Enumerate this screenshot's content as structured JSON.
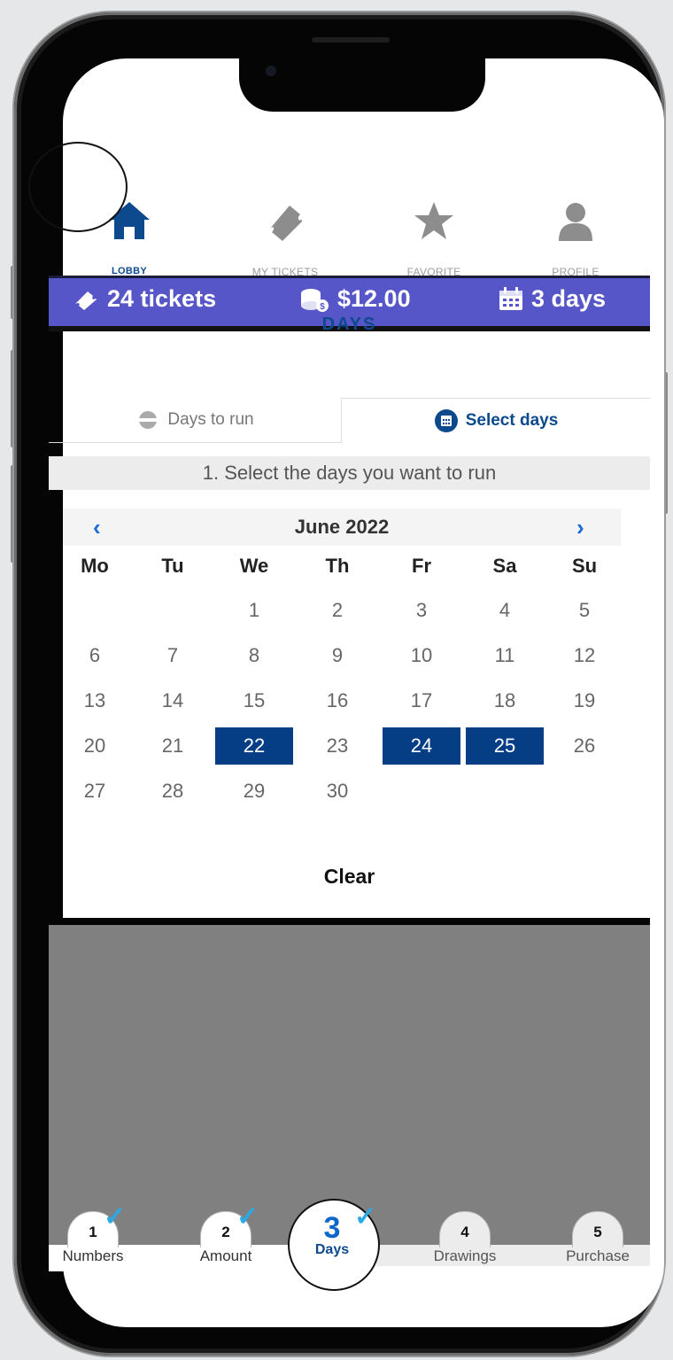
{
  "nav": {
    "items": [
      {
        "label": "LOBBY",
        "icon": "home-icon",
        "active": true
      },
      {
        "label": "MY TICKETS",
        "icon": "ticket-icon",
        "active": false
      },
      {
        "label": "FAVORITE",
        "icon": "star-icon",
        "active": false
      },
      {
        "label": "PROFILE",
        "icon": "person-icon",
        "active": false
      }
    ]
  },
  "summary": {
    "tickets": "24 tickets",
    "amount": "$12.00",
    "days": "3 days"
  },
  "days_panel": {
    "title": "DAYS",
    "tab_days_to_run": "Days to run",
    "tab_select_days": "Select days",
    "instruction": "1. Select the days you want to run",
    "month": "June 2022",
    "prev": "‹",
    "next": "›",
    "weekdays": [
      "Mo",
      "Tu",
      "We",
      "Th",
      "Fr",
      "Sa",
      "Su"
    ],
    "weeks": [
      [
        "",
        "",
        "1",
        "2",
        "3",
        "4",
        "5"
      ],
      [
        "6",
        "7",
        "8",
        "9",
        "10",
        "11",
        "12"
      ],
      [
        "13",
        "14",
        "15",
        "16",
        "17",
        "18",
        "19"
      ],
      [
        "20",
        "21",
        "22",
        "23",
        "24",
        "25",
        "26"
      ],
      [
        "27",
        "28",
        "29",
        "30",
        "",
        "",
        ""
      ]
    ],
    "selected": [
      "22",
      "24",
      "25"
    ],
    "clear": "Clear"
  },
  "steps": [
    {
      "num": "1",
      "label": "Numbers",
      "done": true
    },
    {
      "num": "2",
      "label": "Amount",
      "done": true
    },
    {
      "num": "3",
      "label": "Days",
      "done": true,
      "current": true
    },
    {
      "num": "4",
      "label": "Drawings",
      "done": false
    },
    {
      "num": "5",
      "label": "Purchase",
      "done": false
    }
  ],
  "colors": {
    "brand_blue": "#0d4a8d",
    "summary_bar": "#5756c8",
    "selected_day": "#063e86",
    "check": "#2aa9e6"
  }
}
